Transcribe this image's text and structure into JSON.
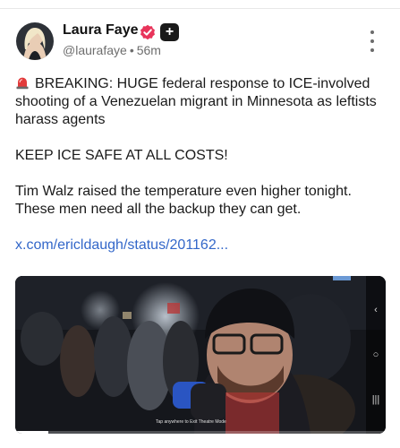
{
  "post": {
    "author": {
      "display_name": "Laura Faye",
      "handle": "@laurafaye",
      "separator": "•",
      "time_ago": "56m",
      "plus_badge": "+"
    },
    "text": {
      "line1": "BREAKING: HUGE federal response to ICE-involved shooting of a Venezuelan migrant in Minnesota as leftists harass agents",
      "line2": "KEEP ICE SAFE AT ALL COSTS!",
      "line3": "Tim Walz raised the temperature even higher tonight. These men need all the backup they can get.",
      "link": "x.com/ericldaugh/status/201162..."
    },
    "video": {
      "caption": "Tap anywhere to Exit Theatre Mode",
      "progress": 0.09,
      "side_controls": [
        "‹",
        "○",
        "|||"
      ]
    }
  },
  "colors": {
    "link": "#3367c9",
    "verified": "#e8345a",
    "meta": "#6e6e6e"
  },
  "icons": [
    "siren-icon",
    "verified-badge-icon",
    "plus-badge-icon",
    "more-options-icon"
  ]
}
